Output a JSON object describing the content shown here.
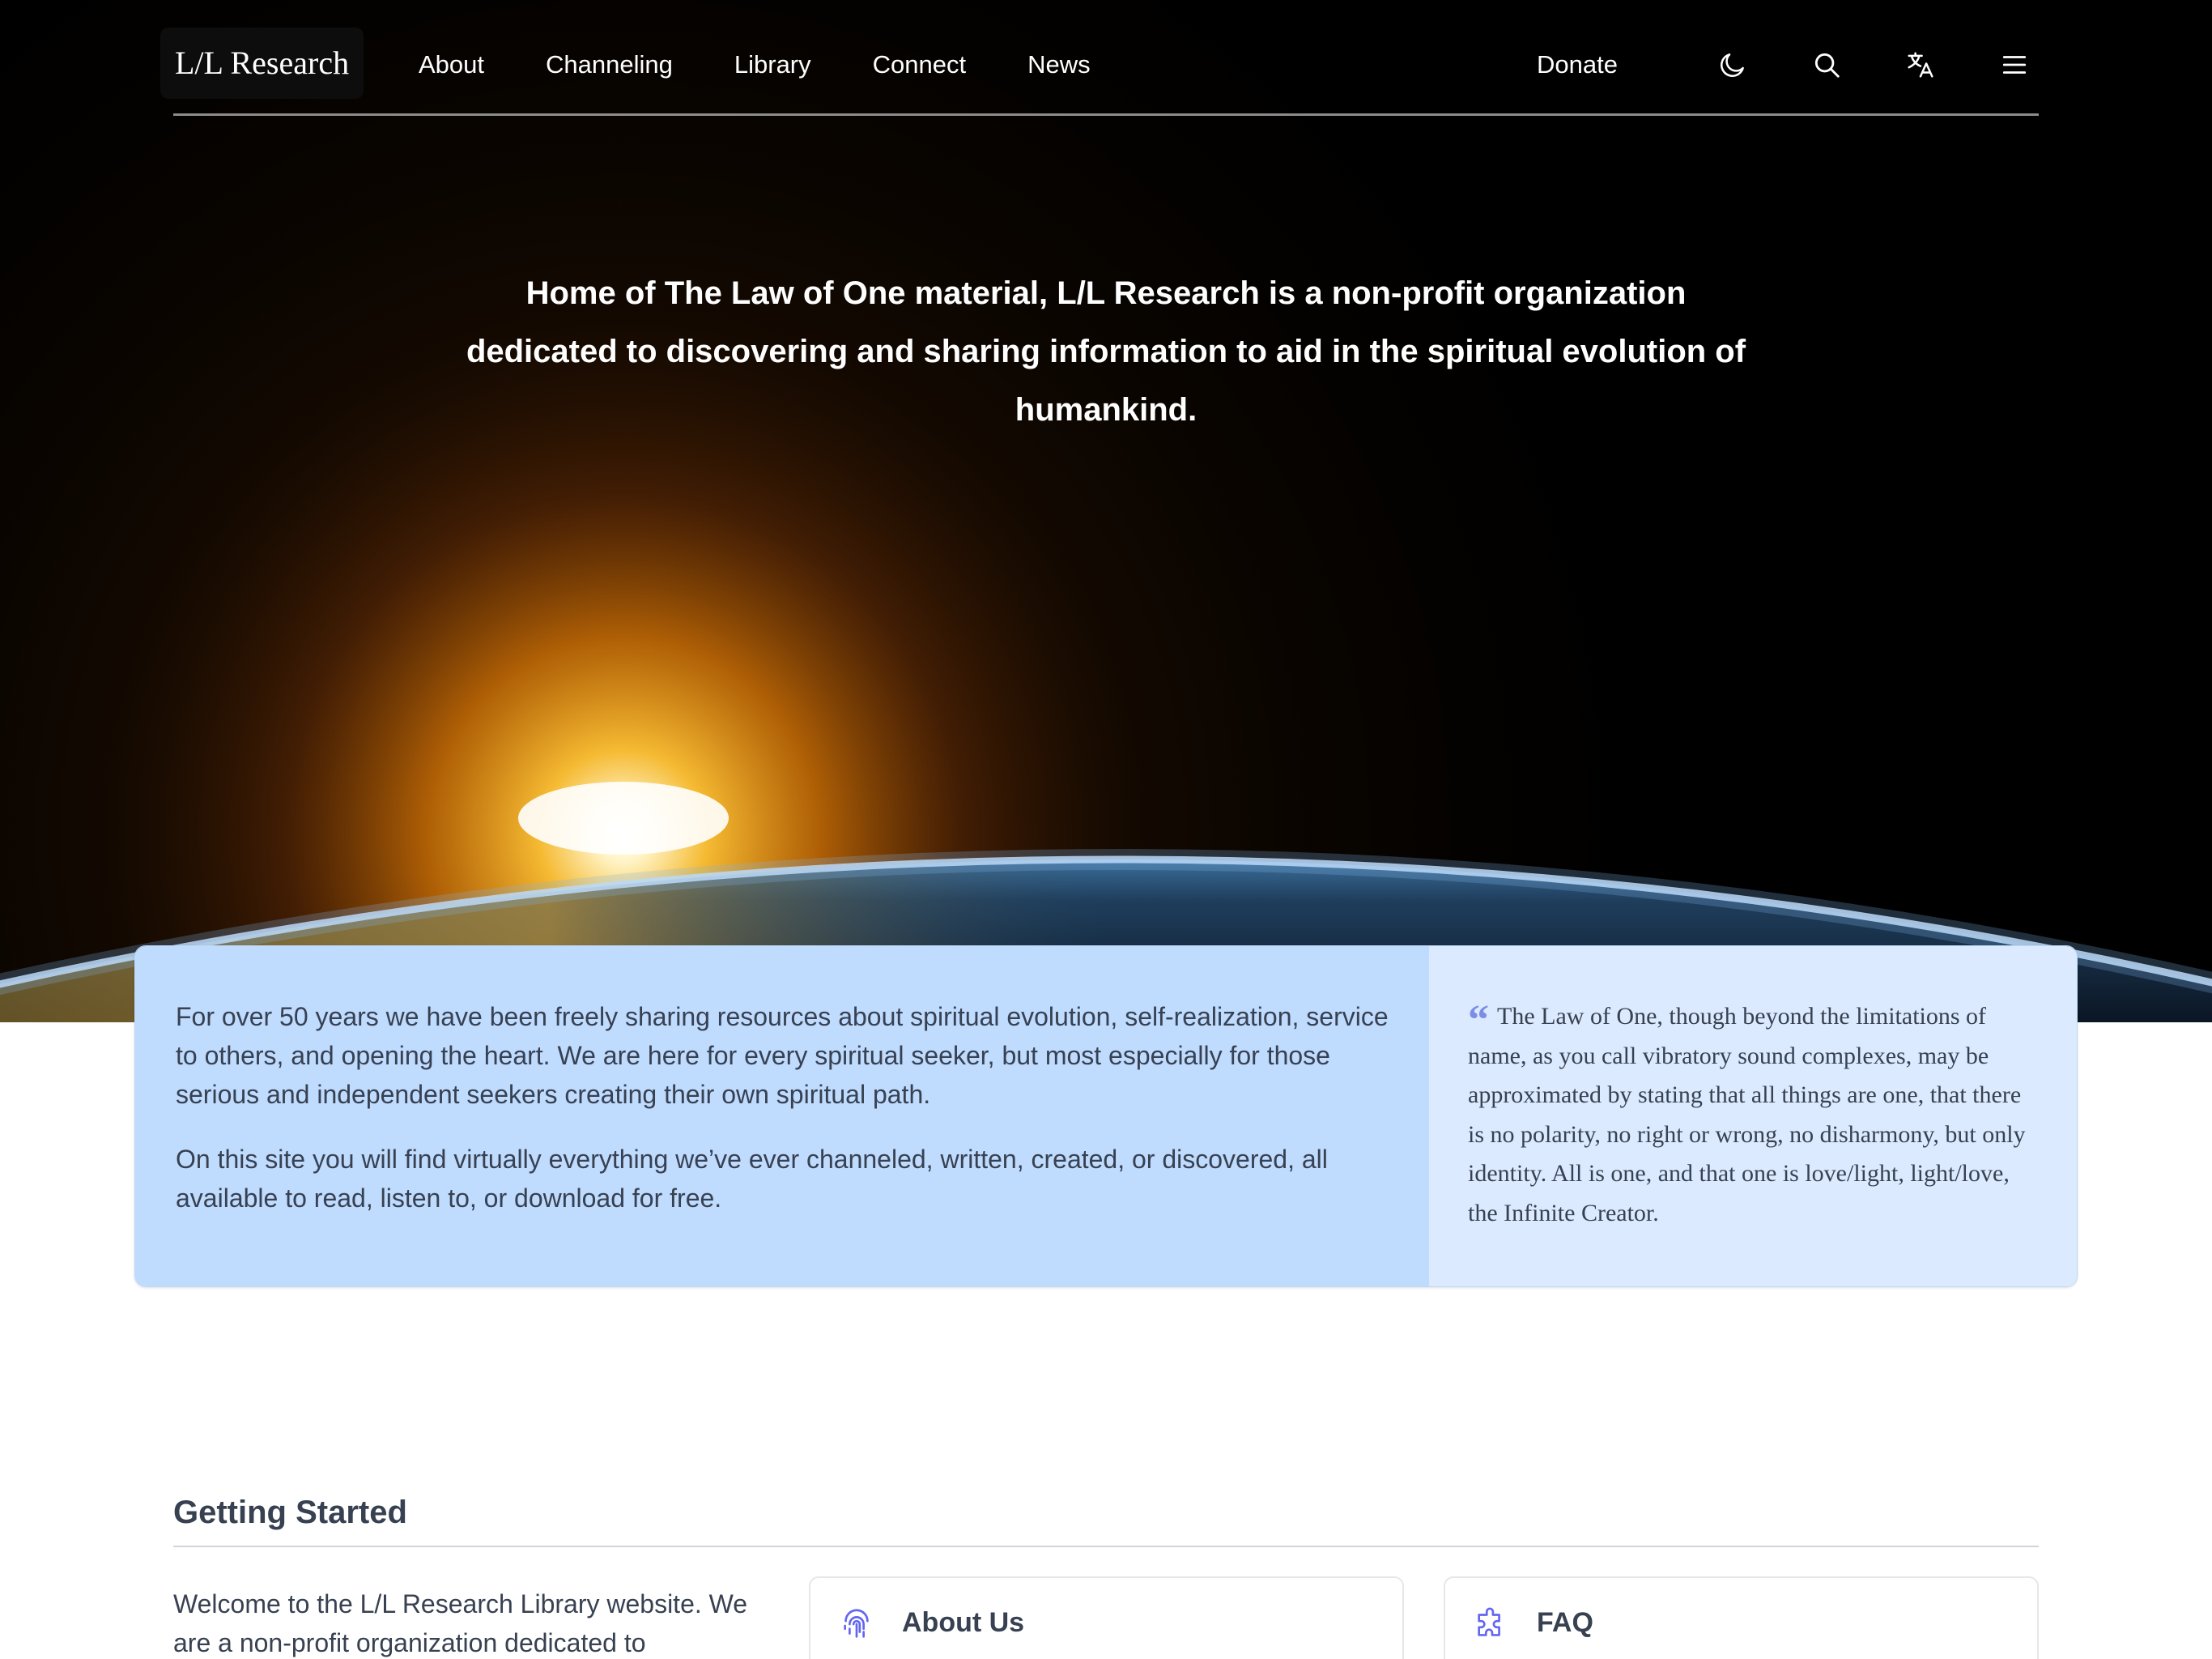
{
  "nav": {
    "logo": "L/L Research",
    "links": [
      "About",
      "Channeling",
      "Library",
      "Connect",
      "News"
    ],
    "donate": "Donate",
    "icons": [
      "moon-icon",
      "search-icon",
      "translate-icon",
      "menu-icon"
    ]
  },
  "hero": {
    "tagline": "Home of The Law of One material, L/L Research is a non-profit organization dedicated to discovering and sharing information to aid in the spiritual evolution of humankind."
  },
  "intro": {
    "paragraphs": [
      "For over 50 years we have been freely sharing resources about spiritual evolution, self-realization, service to others, and opening the heart. We are here for every spiritual seeker, but most especially for those serious and independent seekers creating their own spiritual path.",
      "On this site you will find virtually everything we’ve ever channeled, written, created, or discovered, all available to read, listen to, or download for free."
    ],
    "quote": "The Law of One, though beyond the limitations of name, as you call vibratory sound complexes, may be approximated by stating that all things are one, that there is no polarity, no right or wrong, no disharmony, but only identity. All is one, and that one is love/light, light/love, the Infinite Creator."
  },
  "getting_started": {
    "title": "Getting Started",
    "intro": "Welcome to the L/L Research Library website. We are a non-profit organization dedicated to",
    "cards": [
      {
        "title": "About Us",
        "icon": "fingerprint-icon"
      },
      {
        "title": "FAQ",
        "icon": "puzzle-icon"
      }
    ]
  },
  "colors": {
    "intro_left_bg": "#bfdbfe",
    "intro_right_bg": "#dbeafe",
    "accent_icon": "#6366f1"
  }
}
